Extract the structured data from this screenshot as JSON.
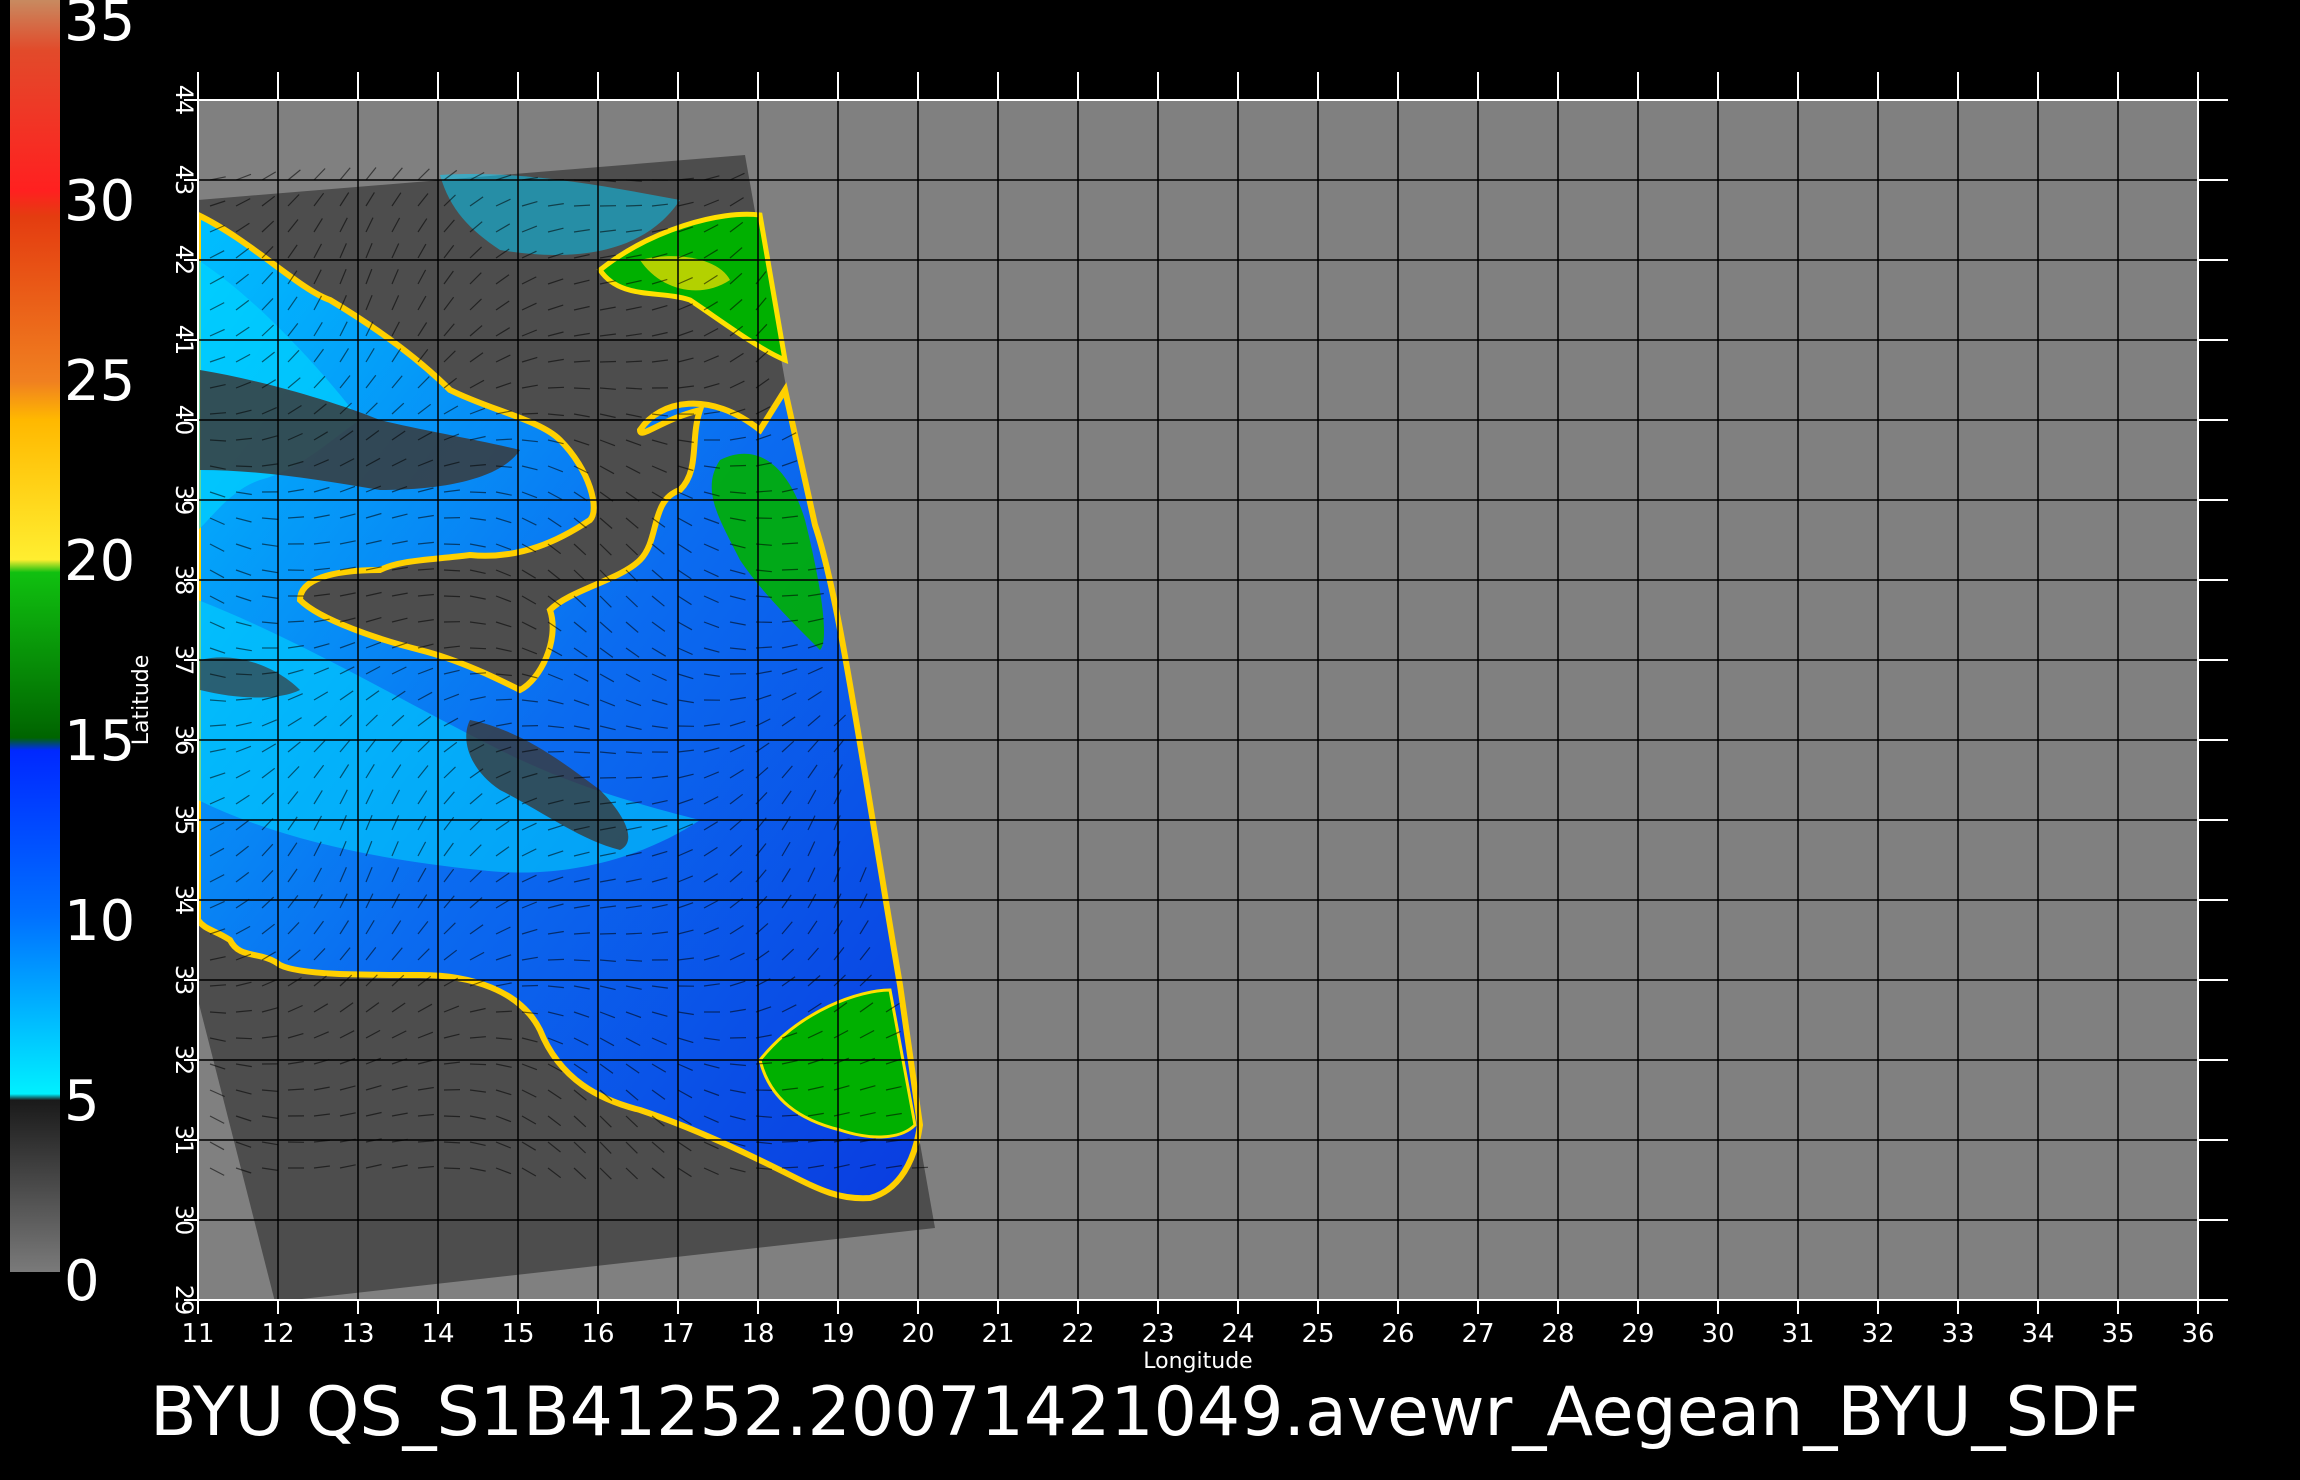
{
  "title": "BYU  QS_S1B41252.20071421049.avewr_Aegean_BYU_SDF",
  "colorbar": {
    "ticks": [
      "35",
      "30",
      "25",
      "20",
      "15",
      "10",
      "5",
      "0"
    ],
    "bands": [
      {
        "from": 30,
        "to": 35,
        "color": "#c87850"
      },
      {
        "from": 25,
        "to": 30,
        "color": "#e8401a"
      },
      {
        "from": 20,
        "to": 25,
        "color": "#ffd000"
      },
      {
        "from": 15,
        "to": 20,
        "color": "#00b000"
      },
      {
        "from": 10,
        "to": 15,
        "color": "#0050ff"
      },
      {
        "from": 5,
        "to": 10,
        "color": "#00d8ff"
      },
      {
        "from": 0,
        "to": 5,
        "color": "#707070"
      }
    ]
  },
  "map": {
    "xlabel": "Longitude",
    "ylabel": "Latitude",
    "lon_range": [
      11,
      36
    ],
    "lat_range": [
      29,
      44
    ],
    "lon_ticks": [
      "11",
      "12",
      "13",
      "14",
      "15",
      "16",
      "17",
      "18",
      "19",
      "20",
      "21",
      "22",
      "23",
      "24",
      "25",
      "26",
      "27",
      "28",
      "29",
      "30",
      "31",
      "32",
      "33",
      "34",
      "35",
      "36"
    ],
    "lat_ticks": [
      "29",
      "30",
      "31",
      "32",
      "33",
      "34",
      "35",
      "36",
      "37",
      "38",
      "39",
      "40",
      "41",
      "42",
      "43",
      "44"
    ],
    "background_color": "#808080",
    "swath_color": "#4d4d4d",
    "ocean_color": "#1a7cf0",
    "grid_color": "#000000"
  }
}
